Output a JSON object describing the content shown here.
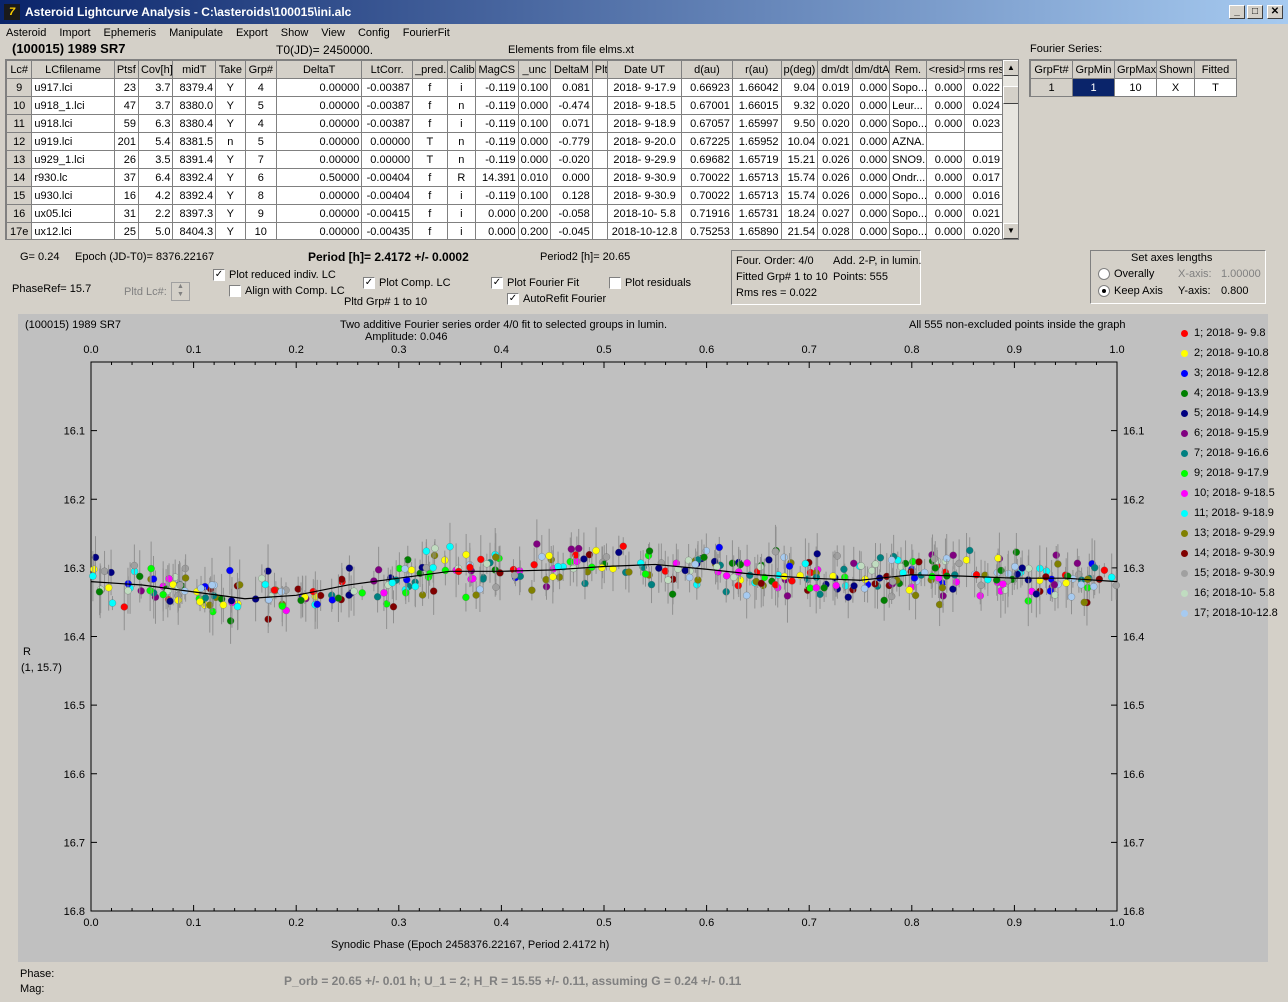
{
  "window": {
    "title": "Asteroid Lightcurve Analysis - C:\\asteroids\\100015\\ini.alc",
    "icon_char": "7"
  },
  "menu": [
    "Asteroid",
    "Import",
    "Ephemeris",
    "Manipulate",
    "Export",
    "Show",
    "View",
    "Config",
    "FourierFit"
  ],
  "header": {
    "asteroid": "(100015) 1989 SR7",
    "t0": "T0(JD)= 2450000.",
    "elements": "Elements from file elms.xt",
    "fourier_series": "Fourier Series:"
  },
  "table": {
    "columns": [
      "Lc#",
      "LCfilename",
      "Ptsf",
      "Cov[h]",
      "midT",
      "Take",
      "Grp#",
      "DeltaT",
      "LtCorr.",
      "_pred.",
      "Calib.",
      "MagCS",
      "_unc",
      "DeltaM",
      "Plt",
      "Date UT",
      "d(au)",
      "r(au)",
      "p(deg)",
      "dm/dt",
      "dm/dtA",
      "Rem.",
      "<resid>",
      "rms res"
    ],
    "rows": [
      [
        "9",
        "u917.lci",
        "23",
        "3.7",
        "8379.4",
        "Y",
        "4",
        "0.00000",
        "-0.00387",
        "f",
        "i",
        "-0.119",
        "0.100",
        "0.081",
        "",
        "2018- 9-17.9",
        "0.66923",
        "1.66042",
        "9.04",
        "0.019",
        "0.000",
        "Sopo...",
        "0.000",
        "0.022"
      ],
      [
        "10",
        "u918_1.lci",
        "47",
        "3.7",
        "8380.0",
        "Y",
        "5",
        "0.00000",
        "-0.00387",
        "f",
        "n",
        "-0.119",
        "0.000",
        "-0.474",
        "",
        "2018- 9-18.5",
        "0.67001",
        "1.66015",
        "9.32",
        "0.020",
        "0.000",
        "Leur...",
        "0.000",
        "0.024"
      ],
      [
        "11",
        "u918.lci",
        "59",
        "6.3",
        "8380.4",
        "Y",
        "4",
        "0.00000",
        "-0.00387",
        "f",
        "i",
        "-0.119",
        "0.100",
        "0.071",
        "",
        "2018- 9-18.9",
        "0.67057",
        "1.65997",
        "9.50",
        "0.020",
        "0.000",
        "Sopo...",
        "0.000",
        "0.023"
      ],
      [
        "12",
        "u919.lci",
        "201",
        "5.4",
        "8381.5",
        "n",
        "5",
        "0.00000",
        "0.00000",
        "T",
        "n",
        "-0.119",
        "0.000",
        "-0.779",
        "",
        "2018- 9-20.0",
        "0.67225",
        "1.65952",
        "10.04",
        "0.021",
        "0.000",
        "AZNA.",
        "",
        ""
      ],
      [
        "13",
        "u929_1.lci",
        "26",
        "3.5",
        "8391.4",
        "Y",
        "7",
        "0.00000",
        "0.00000",
        "T",
        "n",
        "-0.119",
        "0.000",
        "-0.020",
        "",
        "2018- 9-29.9",
        "0.69682",
        "1.65719",
        "15.21",
        "0.026",
        "0.000",
        "SNO9.",
        "0.000",
        "0.019"
      ],
      [
        "14",
        "r930.lc",
        "37",
        "6.4",
        "8392.4",
        "Y",
        "6",
        "0.50000",
        "-0.00404",
        "f",
        "R",
        "14.391",
        "0.010",
        "0.000",
        "",
        "2018- 9-30.9",
        "0.70022",
        "1.65713",
        "15.74",
        "0.026",
        "0.000",
        "Ondr...",
        "0.000",
        "0.017"
      ],
      [
        "15",
        "u930.lci",
        "16",
        "4.2",
        "8392.4",
        "Y",
        "8",
        "0.00000",
        "-0.00404",
        "f",
        "i",
        "-0.119",
        "0.100",
        "0.128",
        "",
        "2018- 9-30.9",
        "0.70022",
        "1.65713",
        "15.74",
        "0.026",
        "0.000",
        "Sopo...",
        "0.000",
        "0.016"
      ],
      [
        "16",
        "ux05.lci",
        "31",
        "2.2",
        "8397.3",
        "Y",
        "9",
        "0.00000",
        "-0.00415",
        "f",
        "i",
        "0.000",
        "0.200",
        "-0.058",
        "",
        "2018-10- 5.8",
        "0.71916",
        "1.65731",
        "18.24",
        "0.027",
        "0.000",
        "Sopo...",
        "0.000",
        "0.021"
      ],
      [
        "17e",
        "ux12.lci",
        "25",
        "5.0",
        "8404.3",
        "Y",
        "10",
        "0.00000",
        "-0.00435",
        "f",
        "i",
        "0.000",
        "0.200",
        "-0.045",
        "",
        "2018-10-12.8",
        "0.75253",
        "1.65890",
        "21.54",
        "0.028",
        "0.000",
        "Sopo...",
        "0.000",
        "0.020"
      ]
    ]
  },
  "fourier_table": {
    "columns": [
      "GrpFt#",
      "GrpMin",
      "GrpMax",
      "Shown",
      "Fitted"
    ],
    "row": [
      "1",
      "1",
      "10",
      "X",
      "T"
    ]
  },
  "info": {
    "g": "G= 0.24",
    "epoch": "Epoch (JD-T0)= 8376.22167",
    "period": "Period [h]= 2.4172 +/- 0.0002",
    "period2": "Period2 [h]= 20.65",
    "phaseref": "PhaseRef= 15.7",
    "pltd_lc": "Pltd Lc#:",
    "plot_reduced": "Plot reduced indiv. LC",
    "align_comp": "Align with Comp. LC",
    "plot_comp": "Plot Comp. LC",
    "pltd_grp": "Pltd Grp#  1   to   10",
    "plot_fourier": "Plot Fourier Fit",
    "autorefit": "AutoRefit Fourier",
    "plot_residuals": "Plot residuals",
    "four_order": "Four. Order:  4/0",
    "add2p": "Add. 2-P, in lumin.",
    "fitted_grp": "Fitted Grp# 1 to 10",
    "points": "Points: 555",
    "rms_res": "Rms res      = 0.022"
  },
  "axes_box": {
    "title": "Set axes lengths",
    "overally": "Overally",
    "keep_axis": "Keep Axis",
    "xaxis_label": "X-axis:",
    "xaxis_value": "1.00000",
    "yaxis_label": "Y-axis:",
    "yaxis_value": "0.800"
  },
  "plot_labels": {
    "top_left": "(100015) 1989 SR7",
    "top_center": "Two additive Fourier series order 4/0 fit to selected groups in lumin.",
    "amplitude": "Amplitude: 0.046",
    "top_right": "All 555 non-excluded points inside the graph",
    "ylabel1": "R",
    "ylabel2": "(1, 15.7)",
    "xlabel": "Synodic Phase (Epoch 2458376.22167, Period 2.4172 h)"
  },
  "bottom": {
    "phase": "Phase:",
    "mag": "Mag:",
    "result": "P_orb = 20.65 +/- 0.01 h; U_1 = 2; H_R = 15.55 +/- 0.11, assuming G = 0.24 +/- 0.11"
  },
  "chart_data": {
    "type": "scatter",
    "xlim": [
      0.0,
      1.0
    ],
    "ylim": [
      16.8,
      16.0
    ],
    "x_ticks": [
      "0.0",
      "0.1",
      "0.2",
      "0.3",
      "0.4",
      "0.5",
      "0.6",
      "0.7",
      "0.8",
      "0.9",
      "1.0"
    ],
    "y_ticks": [
      "16.1",
      "16.2",
      "16.3",
      "16.4",
      "16.5",
      "16.6",
      "16.7",
      "16.8"
    ],
    "series": [
      {
        "name": "1; 2018- 9- 9.8",
        "color": "#ff0000"
      },
      {
        "name": "2; 2018- 9-10.8",
        "color": "#ffff00"
      },
      {
        "name": "3; 2018- 9-12.8",
        "color": "#0000ff"
      },
      {
        "name": "4; 2018- 9-13.9",
        "color": "#008000"
      },
      {
        "name": "5; 2018- 9-14.9",
        "color": "#000080"
      },
      {
        "name": "6; 2018- 9-15.9",
        "color": "#800080"
      },
      {
        "name": "7; 2018- 9-16.6",
        "color": "#008080"
      },
      {
        "name": "9; 2018- 9-17.9",
        "color": "#00ff00"
      },
      {
        "name": "10; 2018- 9-18.5",
        "color": "#ff00ff"
      },
      {
        "name": "11; 2018- 9-18.9",
        "color": "#00ffff"
      },
      {
        "name": "13; 2018- 9-29.9",
        "color": "#808000"
      },
      {
        "name": "14; 2018- 9-30.9",
        "color": "#800000"
      },
      {
        "name": "15; 2018- 9-30.9",
        "color": "#a0a0a0"
      },
      {
        "name": "16; 2018-10- 5.8",
        "color": "#c0dcc0"
      },
      {
        "name": "17; 2018-10-12.8",
        "color": "#a6caf0"
      }
    ],
    "fourier_curve": {
      "x": [
        0.0,
        0.05,
        0.1,
        0.15,
        0.2,
        0.25,
        0.3,
        0.35,
        0.4,
        0.45,
        0.5,
        0.55,
        0.6,
        0.65,
        0.7,
        0.75,
        0.8,
        0.85,
        0.9,
        0.95,
        1.0
      ],
      "y": [
        16.32,
        16.325,
        16.335,
        16.345,
        16.34,
        16.325,
        16.315,
        16.305,
        16.305,
        16.303,
        16.298,
        16.295,
        16.302,
        16.31,
        16.315,
        16.318,
        16.31,
        16.312,
        16.315,
        16.315,
        16.32
      ]
    }
  }
}
